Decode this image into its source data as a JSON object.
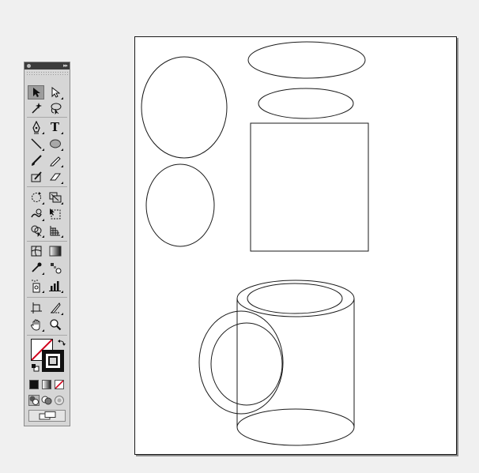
{
  "toolbox": {
    "title": "",
    "collapse_glyph": "▸▸",
    "tools": [
      {
        "name": "selection-tool",
        "icon": "arrow-icon",
        "selected": true
      },
      {
        "name": "direct-selection-tool",
        "icon": "hollow-arrow-icon",
        "selected": false
      },
      {
        "name": "magic-wand-tool",
        "icon": "magic-wand-icon",
        "selected": false
      },
      {
        "name": "lasso-tool",
        "icon": "lasso-icon",
        "selected": false
      },
      {
        "name": "pen-tool",
        "icon": "pen-nib-icon",
        "selected": false
      },
      {
        "name": "type-tool",
        "icon": "type-icon",
        "label": "T",
        "selected": false
      },
      {
        "name": "line-segment-tool",
        "icon": "line-icon",
        "selected": false
      },
      {
        "name": "ellipse-tool",
        "icon": "ellipse-icon",
        "selected": false
      },
      {
        "name": "paintbrush-tool",
        "icon": "paintbrush-icon",
        "selected": false
      },
      {
        "name": "pencil-tool",
        "icon": "pencil-icon",
        "selected": false
      },
      {
        "name": "blob-brush-tool",
        "icon": "blob-brush-icon",
        "selected": false
      },
      {
        "name": "eraser-tool",
        "icon": "eraser-icon",
        "selected": false
      },
      {
        "name": "rotate-tool",
        "icon": "rotate-icon",
        "selected": false
      },
      {
        "name": "scale-tool",
        "icon": "scale-icon",
        "selected": false
      },
      {
        "name": "warp-tool",
        "icon": "warp-icon",
        "selected": false
      },
      {
        "name": "free-transform-tool",
        "icon": "free-transform-icon",
        "selected": false
      },
      {
        "name": "shape-builder-tool",
        "icon": "shape-builder-icon",
        "selected": false
      },
      {
        "name": "perspective-grid-tool",
        "icon": "perspective-grid-icon",
        "selected": false
      },
      {
        "name": "mesh-tool",
        "icon": "mesh-icon",
        "selected": false
      },
      {
        "name": "gradient-tool",
        "icon": "gradient-icon",
        "selected": false
      },
      {
        "name": "eyedropper-tool",
        "icon": "eyedropper-icon",
        "selected": false
      },
      {
        "name": "blend-tool",
        "icon": "blend-icon",
        "selected": false
      },
      {
        "name": "symbol-sprayer-tool",
        "icon": "symbol-sprayer-icon",
        "selected": false
      },
      {
        "name": "column-graph-tool",
        "icon": "column-graph-icon",
        "selected": false
      },
      {
        "name": "artboard-tool",
        "icon": "artboard-icon",
        "selected": false
      },
      {
        "name": "slice-tool",
        "icon": "slice-icon",
        "selected": false
      },
      {
        "name": "hand-tool",
        "icon": "hand-icon",
        "selected": false
      },
      {
        "name": "zoom-tool",
        "icon": "zoom-icon",
        "selected": false
      }
    ],
    "fill_stroke": {
      "fill": "none",
      "stroke": "#000000"
    },
    "color_modes": [
      "color",
      "gradient",
      "none"
    ],
    "draw_modes": [
      "draw-normal",
      "draw-behind",
      "draw-inside"
    ],
    "screen_mode": "change-screen-mode"
  },
  "colors": {
    "workspace": "#f0f0f0",
    "panel": "#d6d6d6",
    "titlebar": "#3c3c3c",
    "artboard": "#ffffff",
    "stroke": "#1a1a1a",
    "none_slash": "#d0021b"
  },
  "artwork": {
    "objects": [
      {
        "type": "ellipse",
        "name": "tall-ellipse"
      },
      {
        "type": "ellipse",
        "name": "small-ellipse-left"
      },
      {
        "type": "ellipse",
        "name": "wide-ellipse-top"
      },
      {
        "type": "ellipse",
        "name": "wide-ellipse-second"
      },
      {
        "type": "rectangle",
        "name": "rectangle"
      },
      {
        "type": "cylinder",
        "name": "mug-body"
      },
      {
        "type": "handle",
        "name": "mug-handle"
      }
    ]
  }
}
